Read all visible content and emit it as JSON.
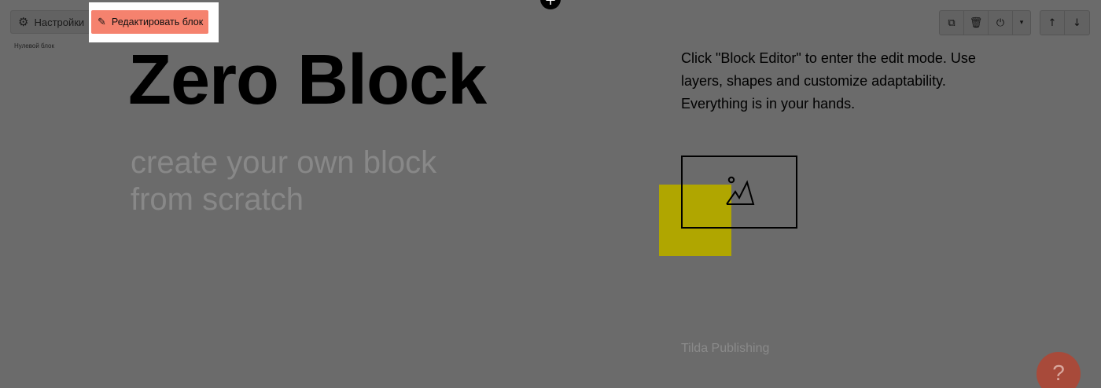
{
  "add_button": {
    "icon": "plus-icon",
    "symbol": "+"
  },
  "left_controls": {
    "settings": {
      "label": "Настройки",
      "icon": "gear-icon",
      "glyph": "⚙"
    },
    "edit_block": {
      "label": "Редактировать блок",
      "icon": "pencil-icon",
      "glyph": "✎",
      "color": "#f5826e"
    },
    "block_type_label": "Нулевой блок"
  },
  "toolbar": {
    "group1": [
      {
        "name": "duplicate-icon",
        "glyph": "⧉"
      },
      {
        "name": "trash-icon",
        "glyph": "🗑"
      },
      {
        "name": "power-icon",
        "glyph": "⏻"
      },
      {
        "name": "chevron-down-icon",
        "glyph": "▾"
      }
    ],
    "group2": [
      {
        "name": "arrow-up-icon",
        "glyph": "↑"
      },
      {
        "name": "arrow-down-icon",
        "glyph": "↓"
      }
    ]
  },
  "block": {
    "title": "Zero Block",
    "subtitle": "create your own block from scratch",
    "description": "Click \"Block Editor\" to enter the edit mode. Use layers, shapes and customize adaptability. Everything is in your hands.",
    "accent_color": "#b0a600",
    "image_icon": "image-placeholder-icon",
    "brand": "Tilda Publishing"
  },
  "help_button": {
    "icon": "question-icon",
    "symbol": "?"
  }
}
